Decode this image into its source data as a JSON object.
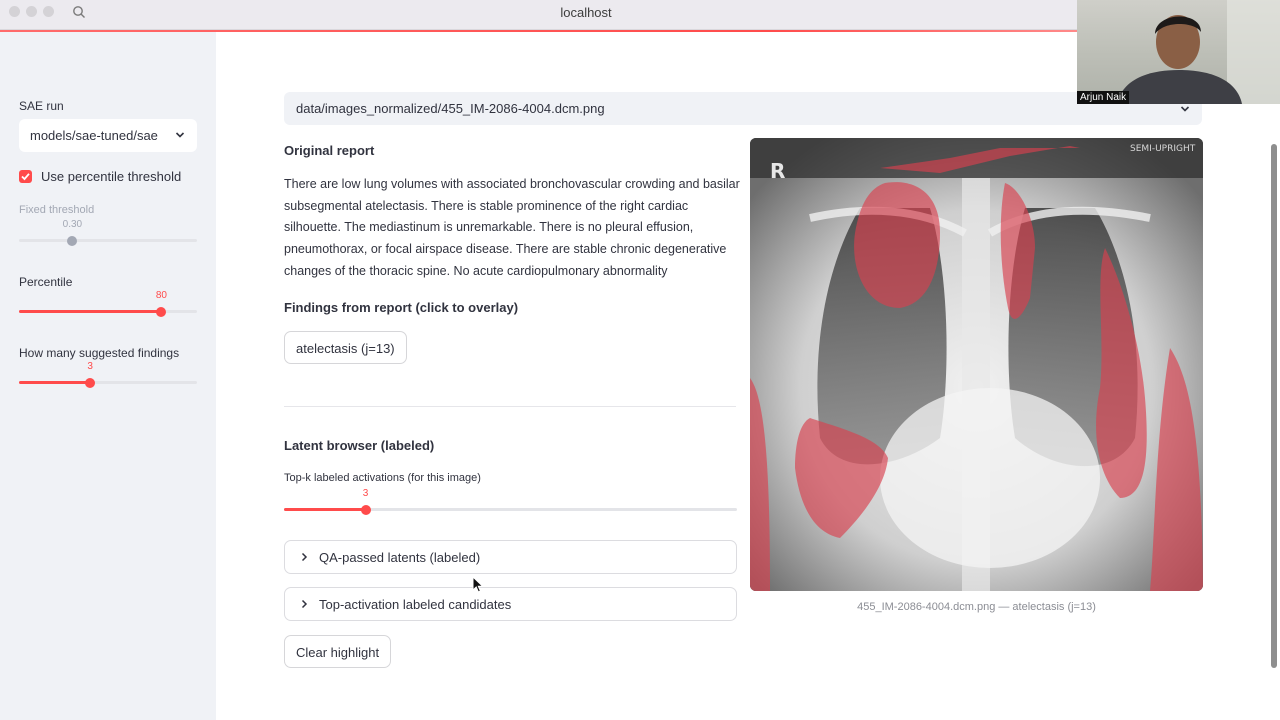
{
  "browser": {
    "host": "localhost"
  },
  "webcam": {
    "name": "Arjun Naik"
  },
  "sidebar": {
    "sae_run_label": "SAE run",
    "sae_run_value": "models/sae-tuned/sae",
    "use_percentile_label": "Use percentile threshold",
    "use_percentile_checked": true,
    "fixed_threshold_label": "Fixed threshold",
    "fixed_threshold_value": "0.30",
    "fixed_threshold_fraction": 0.3,
    "percentile_label": "Percentile",
    "percentile_value": "80",
    "percentile_fraction": 0.8,
    "suggested_label": "How many suggested findings",
    "suggested_value": "3",
    "suggested_fraction": 0.4
  },
  "main": {
    "image_path": "data/images_normalized/455_IM-2086-4004.dcm.png",
    "original_report_heading": "Original report",
    "report_text": "There are low lung volumes with associated bronchovascular crowding and basilar subsegmental atelectasis. There is stable prominence of the right cardiac silhouette. The mediastinum is unremarkable. There is no pleural effusion, pneumothorax, or focal airspace disease. There are stable chronic degenerative changes of the thoracic spine. No acute cardiopulmonary abnormality",
    "findings_heading": "Findings from report (click to overlay)",
    "finding_chip": "atelectasis (j=13)",
    "latent_heading": "Latent browser (labeled)",
    "topk_label": "Top-k labeled activations (for this image)",
    "topk_value": "3",
    "topk_fraction": 0.18,
    "expander_qa": "QA-passed latents (labeled)",
    "expander_top": "Top-activation labeled candidates",
    "clear_button": "Clear highlight",
    "image_caption": "455_IM-2086-4004.dcm.png — atelectasis (j=13)",
    "xray_marker": "R",
    "xray_tag": "SEMI-UPRIGHT"
  },
  "colors": {
    "accent": "#ff4b4b",
    "sidebar_bg": "#f0f2f6",
    "overlay": "#d9414f"
  }
}
